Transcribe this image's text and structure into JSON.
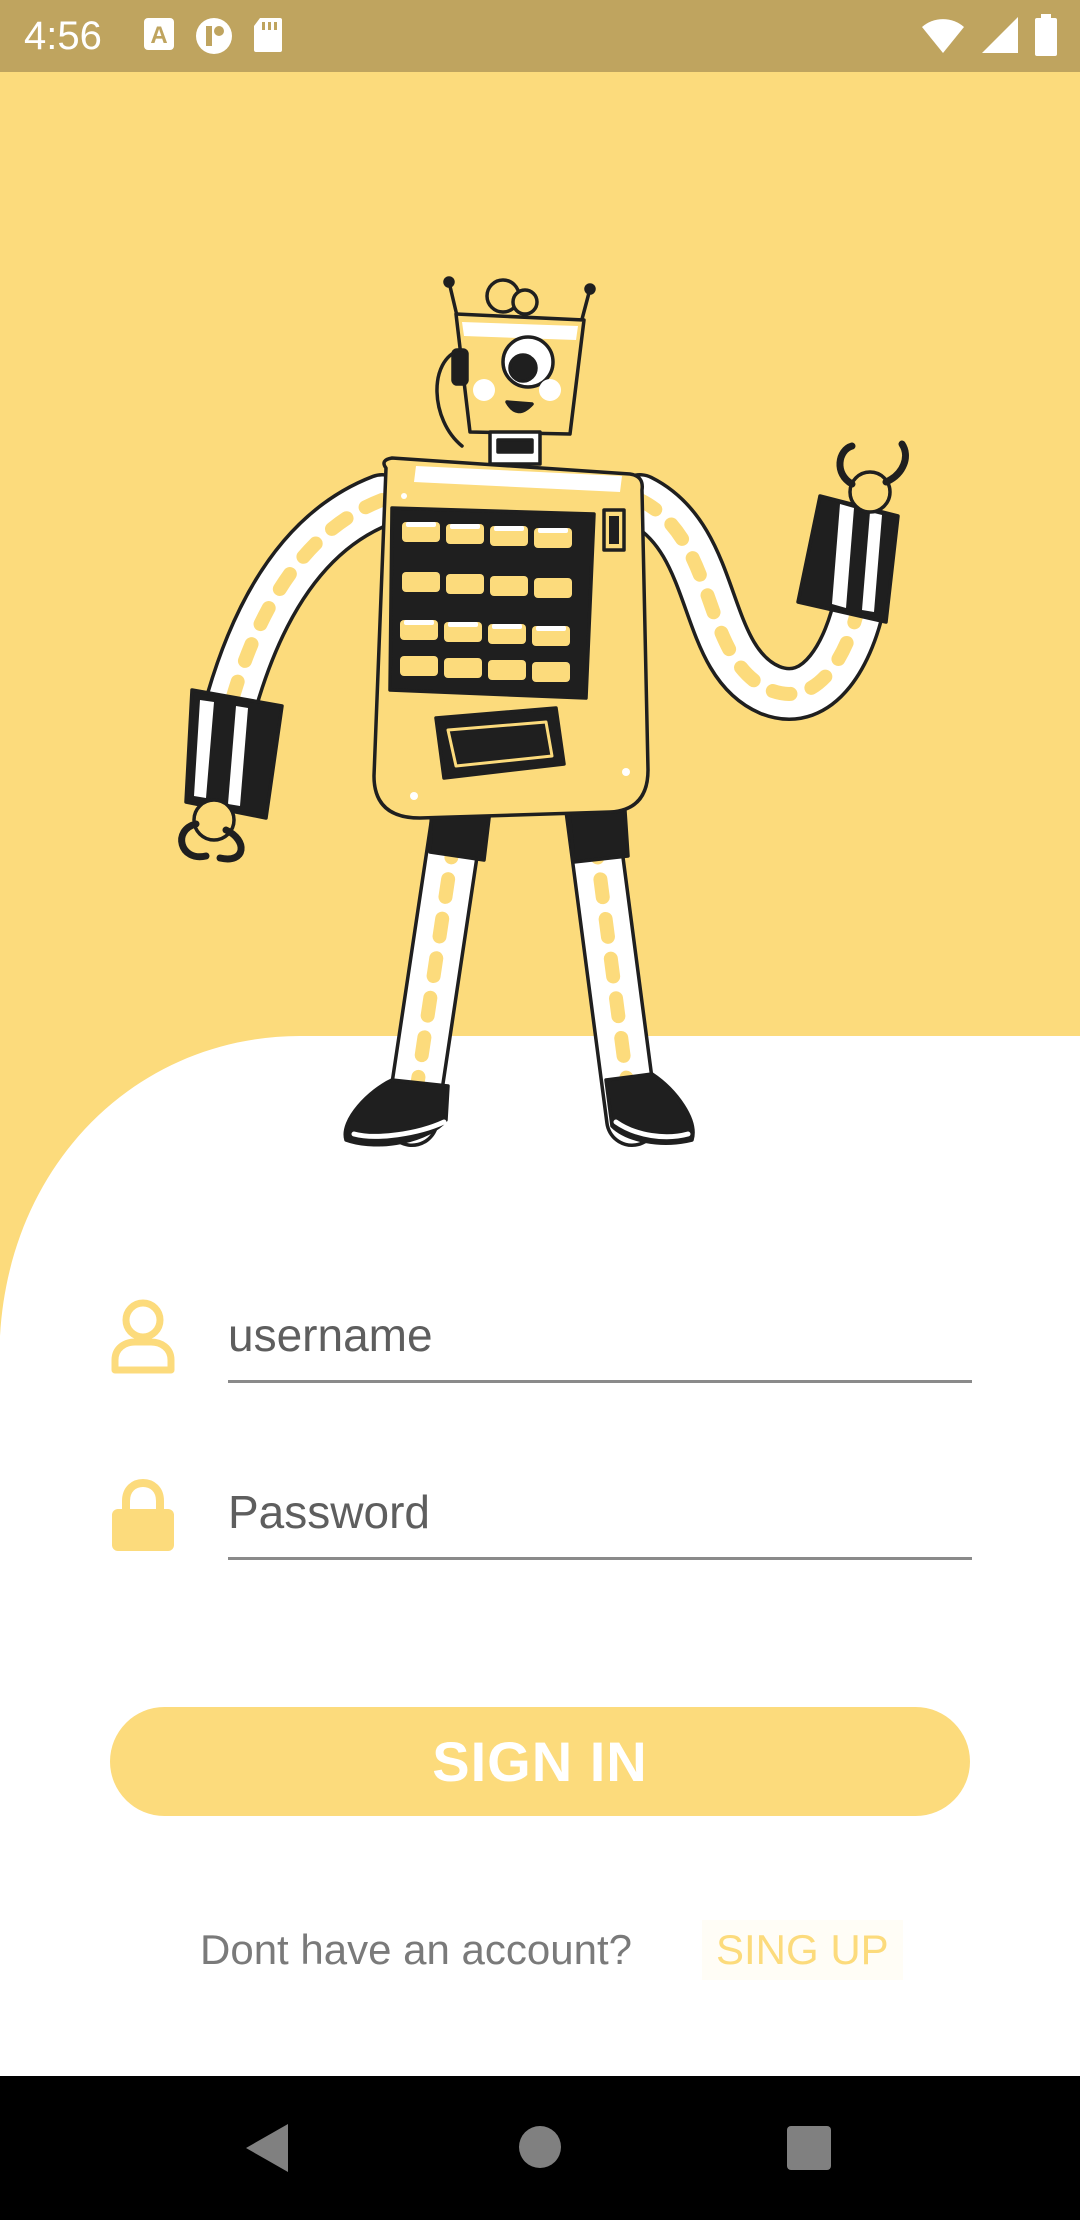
{
  "status_bar": {
    "time": "4:56",
    "left_icons": [
      "a-badge-icon",
      "podcast-icon",
      "sd-card-icon"
    ],
    "right_icons": [
      "wifi-icon",
      "signal-icon",
      "battery-icon"
    ]
  },
  "hero": {
    "background_color": "#FCDB7C",
    "illustration": "robot-waving-illustration"
  },
  "form": {
    "username": {
      "placeholder": "username",
      "value": "",
      "icon": "user-icon"
    },
    "password": {
      "placeholder": "Password",
      "value": "",
      "icon": "lock-icon"
    },
    "sign_in_label": "SIGN IN"
  },
  "footer": {
    "prompt": "Dont have an account?",
    "sign_up_label": "SING UP"
  },
  "nav_bar": {
    "buttons": [
      "back-icon",
      "home-icon",
      "recents-icon"
    ]
  },
  "colors": {
    "accent": "#FCDB7C",
    "status_bar": "#BFA45F",
    "robot_ink": "#1f1f1f"
  }
}
